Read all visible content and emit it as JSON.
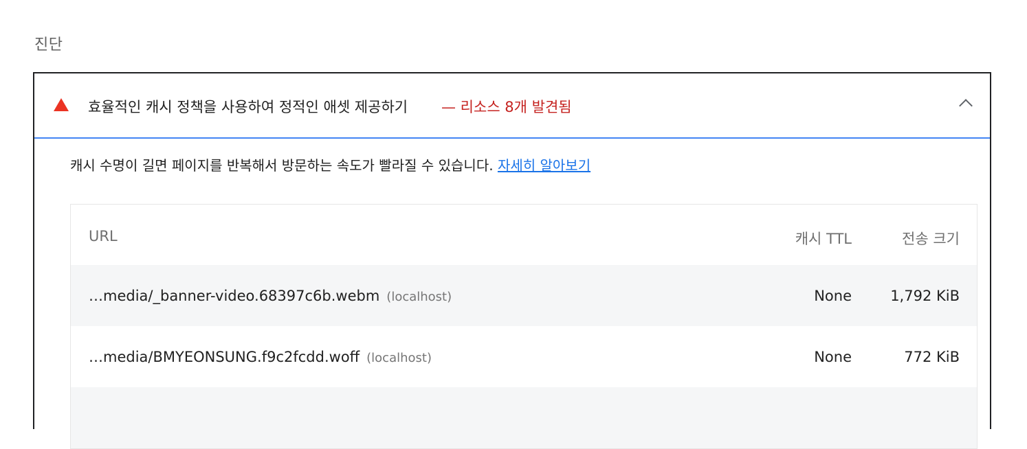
{
  "section_title": "진단",
  "audit": {
    "title": "효율적인 캐시 정책을 사용하여 정적인 애셋 제공하기",
    "display_value": "— 리소스 8개 발견됨",
    "description": "캐시 수명이 길면 페이지를 반복해서 방문하는 속도가 빨라질 수 있습니다.",
    "learn_more": "자세히 알아보기",
    "status_color": "#eb3323"
  },
  "table": {
    "headers": {
      "url": "URL",
      "ttl": "캐시 TTL",
      "size": "전송 크기"
    },
    "rows": [
      {
        "url": "…media/_banner-video.68397c6b.webm",
        "host": "(localhost)",
        "ttl": "None",
        "size": "1,792 KiB"
      },
      {
        "url": "…media/BMYEONSUNG.f9c2fcdd.woff",
        "host": "(localhost)",
        "ttl": "None",
        "size": "772 KiB"
      }
    ]
  }
}
